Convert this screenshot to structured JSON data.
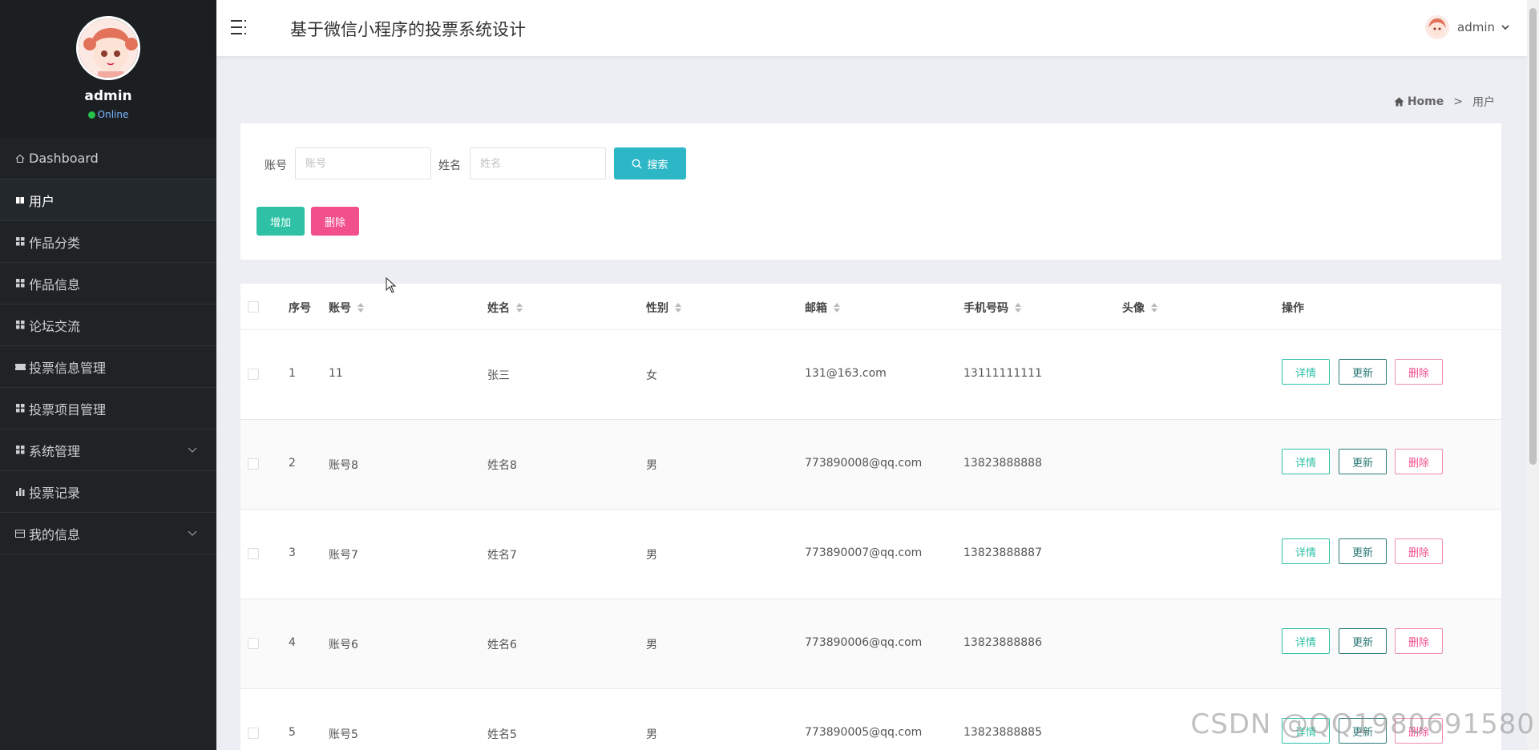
{
  "sidebar": {
    "profile_name": "admin",
    "profile_status": "Online",
    "items": [
      {
        "label": "Dashboard",
        "icon": "home-icon"
      },
      {
        "label": "用户",
        "icon": "book-icon"
      },
      {
        "label": "作品分类",
        "icon": "grid-icon"
      },
      {
        "label": "作品信息",
        "icon": "grid-icon"
      },
      {
        "label": "论坛交流",
        "icon": "grid-icon"
      },
      {
        "label": "投票信息管理",
        "icon": "ticket-icon"
      },
      {
        "label": "投票项目管理",
        "icon": "grid-icon"
      },
      {
        "label": "系统管理",
        "icon": "grid-icon"
      },
      {
        "label": "投票记录",
        "icon": "bar-chart-icon"
      },
      {
        "label": "我的信息",
        "icon": "card-icon"
      }
    ]
  },
  "header": {
    "title": "基于微信小程序的投票系统设计",
    "username": "admin"
  },
  "breadcrumb": {
    "home": "Home",
    "separator": ">",
    "current": "用户"
  },
  "search": {
    "account_label": "账号",
    "account_placeholder": "账号",
    "name_label": "姓名",
    "name_placeholder": "姓名",
    "search_button": "搜索",
    "add_button": "增加",
    "delete_button": "删除"
  },
  "table": {
    "columns": [
      "序号",
      "账号",
      "姓名",
      "性别",
      "邮箱",
      "手机号码",
      "头像",
      "操作"
    ],
    "actions": {
      "detail": "详情",
      "update": "更新",
      "delete": "删除"
    },
    "rows": [
      {
        "index": "1",
        "account": "11",
        "name": "张三",
        "gender": "女",
        "email": "131@163.com",
        "phone": "13111111111"
      },
      {
        "index": "2",
        "account": "账号8",
        "name": "姓名8",
        "gender": "男",
        "email": "773890008@qq.com",
        "phone": "13823888888"
      },
      {
        "index": "3",
        "account": "账号7",
        "name": "姓名7",
        "gender": "男",
        "email": "773890007@qq.com",
        "phone": "13823888887"
      },
      {
        "index": "4",
        "account": "账号6",
        "name": "姓名6",
        "gender": "男",
        "email": "773890006@qq.com",
        "phone": "13823888886"
      },
      {
        "index": "5",
        "account": "账号5",
        "name": "姓名5",
        "gender": "男",
        "email": "773890005@qq.com",
        "phone": "13823888885"
      }
    ]
  },
  "watermark": "CSDN @QQ1980691580",
  "colors": {
    "sidebar_bg": "#1f2326",
    "search_button": "#2db7c6",
    "add_button": "#2ec1a5",
    "delete_button": "#f24f8d"
  }
}
